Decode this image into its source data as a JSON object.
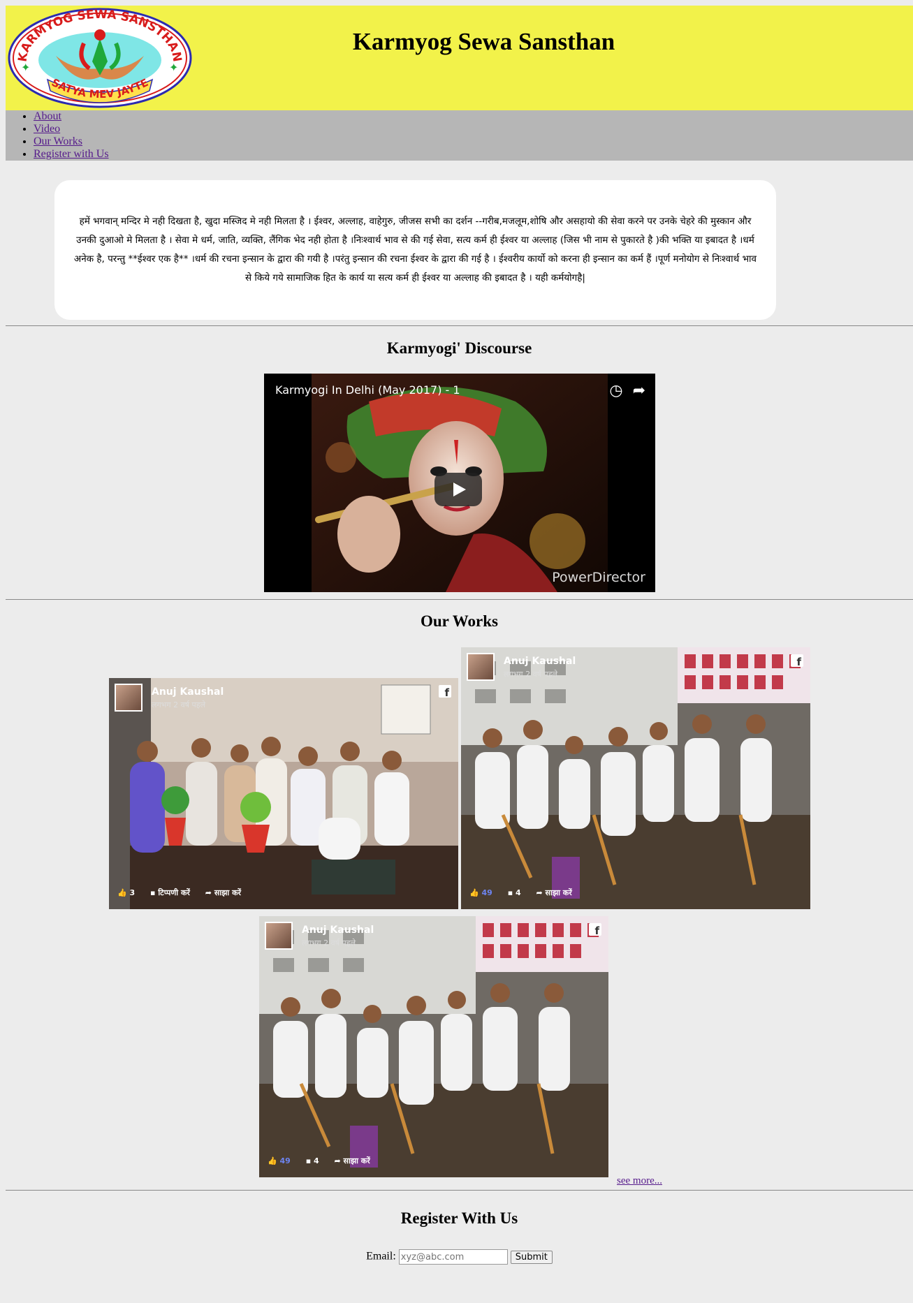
{
  "site": {
    "title": "Karmyog Sewa Sansthan",
    "logo_top_text": "KARMYOG SEWA SANSTHAN",
    "logo_bottom_text": "SATYA MEV JAYTE"
  },
  "nav": {
    "items": [
      {
        "label": "About"
      },
      {
        "label": "Video"
      },
      {
        "label": "Our Works"
      },
      {
        "label": "Register with Us"
      }
    ]
  },
  "intro": {
    "text": "हमें भगवान् मन्दिर मे नही दिखता है, खुदा मस्जिद मे नही मिलता है । ईश्वर, अल्लाह, वाहेगुरु, जीजस सभी का दर्शन --गरीब,मजलूम,शोषि और असहायो की सेवा करने पर उनके चेहरे की मुस्कान और उनकी दुआओ मे मिलता है । सेवा मे धर्म, जाति, व्यक्ति, लैंगिक भेद नही होता है ।निःश्वार्थ भाव से की गई सेवा, सत्य कर्म ही ईश्वर या अल्लाह (जिस भी नाम से पुकारते है )की भक्ति या इबादत है ।धर्म अनेक है, परन्तु **ईश्वर एक है** ।धर्म की रचना इन्सान के द्वारा की गयी है ।परंतु इन्सान की रचना ईश्वर के द्वारा की गई है । ईश्वरीय कार्यो को करना ही इन्सान का कर्म हैं ।पूर्ण मनोयोग से निःश्वार्थ भाव से किये गये सामाजिक हित के कार्य या सत्य कर्म ही ईश्वर या अल्लाह की इबादत है । यही कर्मयोगहै|"
  },
  "discourse": {
    "heading": "Karmyogi' Discourse",
    "video_title": "Karmyogi In Delhi (May 2017) - 1",
    "watermark": "PowerDirector"
  },
  "works": {
    "heading": "Our Works",
    "posts": [
      {
        "author": "Anuj Kaushal",
        "when": "लगभग 2 वर्ष पहले",
        "likes": "3",
        "comment_label": "टिप्पणी करें",
        "share_label": "साझा करें"
      },
      {
        "author": "Anuj Kaushal",
        "when": "लगभग 2 वर्ष पहले",
        "likes": "49",
        "comments": "4",
        "share_label": "साझा करें"
      },
      {
        "author": "Anuj Kaushal",
        "when": "लगभग 2 वर्ष पहले",
        "likes": "49",
        "comments": "4",
        "share_label": "साझा करें"
      }
    ],
    "see_more": "see more..."
  },
  "register": {
    "heading": "Register With Us",
    "email_label": "Email:",
    "email_placeholder": "xyz@abc.com",
    "submit_label": "Submit"
  },
  "colors": {
    "header_bg": "#f2f24a",
    "nav_bg": "#b6b6b6",
    "page_bg": "#ececec",
    "link": "#551a8b"
  }
}
